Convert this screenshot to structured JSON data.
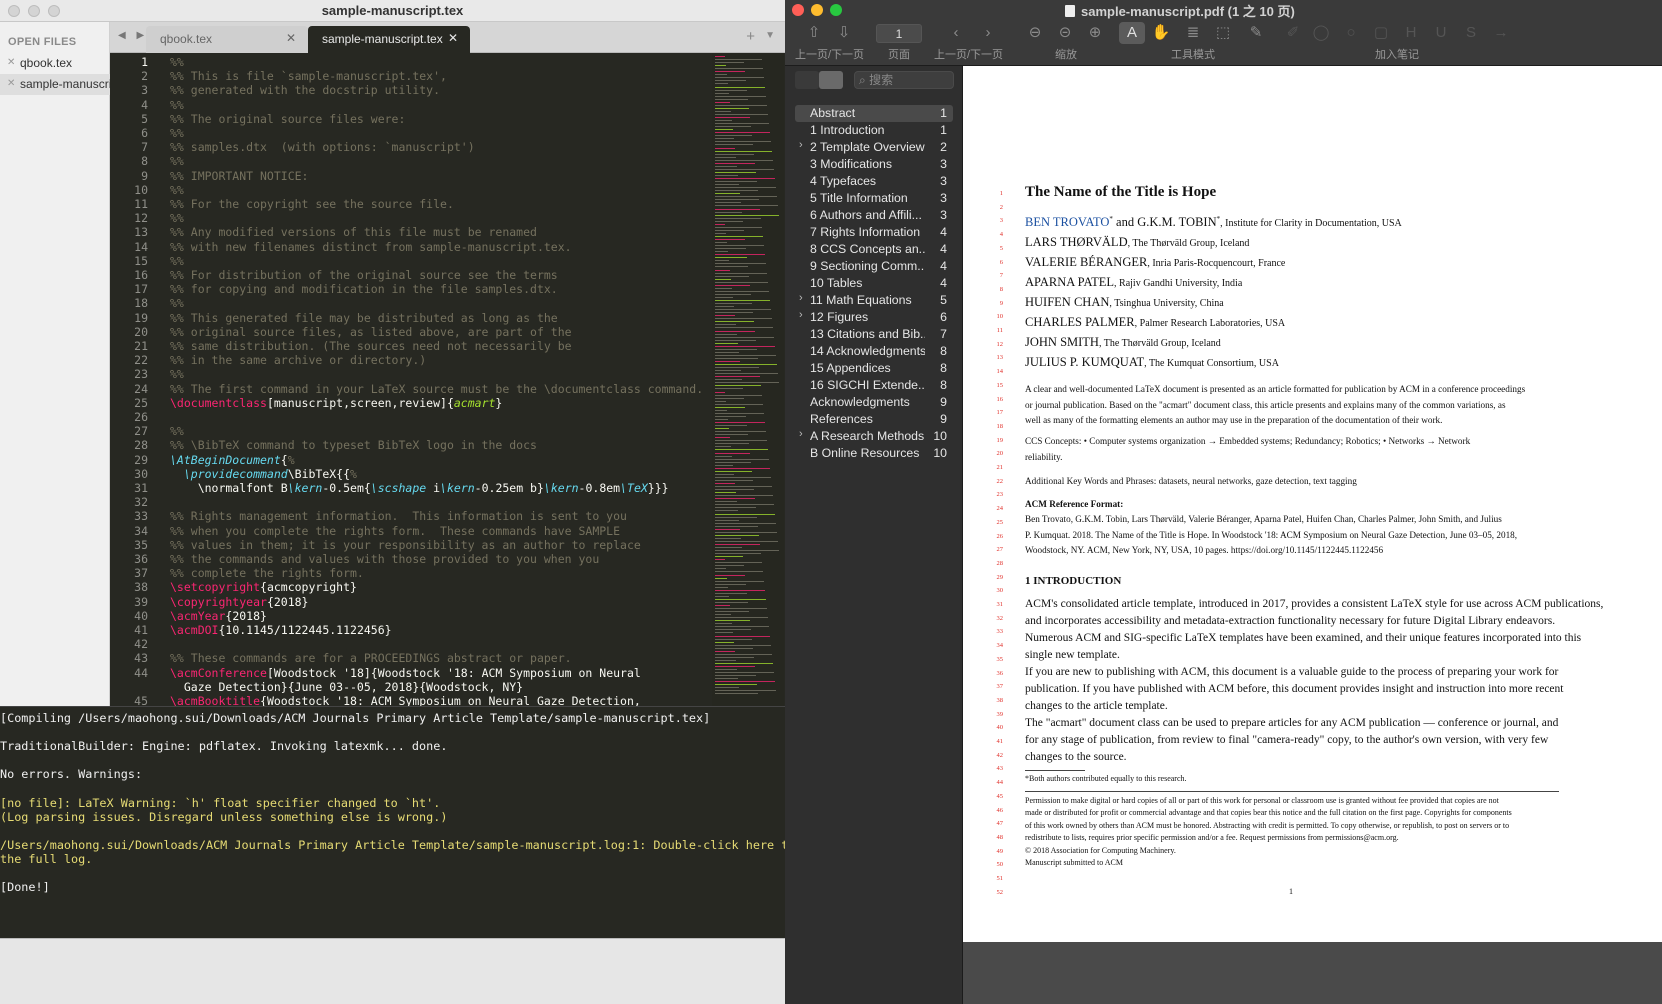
{
  "sublime": {
    "title": "sample-manuscript.tex",
    "sidebar": {
      "header": "OPEN FILES",
      "files": [
        {
          "name": "qbook.tex",
          "close": "✕"
        },
        {
          "name": "sample-manuscript.tex",
          "close": "✕"
        }
      ]
    },
    "tabs": [
      {
        "name": "qbook.tex",
        "close": "✕"
      },
      {
        "name": "sample-manuscript.tex",
        "close": "✕"
      }
    ],
    "tab_nav": "◀ ▶",
    "tab_add": "+",
    "tab_menu": "▼",
    "code_lines": [
      {
        "n": "1",
        "segs": [
          [
            "c",
            "%%"
          ]
        ]
      },
      {
        "n": "2",
        "segs": [
          [
            "c",
            "%% This is file `sample-manuscript.tex',"
          ]
        ]
      },
      {
        "n": "3",
        "segs": [
          [
            "c",
            "%% generated with the docstrip utility."
          ]
        ]
      },
      {
        "n": "4",
        "segs": [
          [
            "c",
            "%%"
          ]
        ]
      },
      {
        "n": "5",
        "segs": [
          [
            "c",
            "%% The original source files were:"
          ]
        ]
      },
      {
        "n": "6",
        "segs": [
          [
            "c",
            "%%"
          ]
        ]
      },
      {
        "n": "7",
        "segs": [
          [
            "c",
            "%% samples.dtx  (with options: `manuscript')"
          ]
        ]
      },
      {
        "n": "8",
        "segs": [
          [
            "c",
            "%%"
          ]
        ]
      },
      {
        "n": "9",
        "segs": [
          [
            "c",
            "%% IMPORTANT NOTICE:"
          ]
        ]
      },
      {
        "n": "10",
        "segs": [
          [
            "c",
            "%%"
          ]
        ]
      },
      {
        "n": "11",
        "segs": [
          [
            "c",
            "%% For the copyright see the source file."
          ]
        ]
      },
      {
        "n": "12",
        "segs": [
          [
            "c",
            "%%"
          ]
        ]
      },
      {
        "n": "13",
        "segs": [
          [
            "c",
            "%% Any modified versions of this file must be renamed"
          ]
        ]
      },
      {
        "n": "14",
        "segs": [
          [
            "c",
            "%% with new filenames distinct from sample-manuscript.tex."
          ]
        ]
      },
      {
        "n": "15",
        "segs": [
          [
            "c",
            "%%"
          ]
        ]
      },
      {
        "n": "16",
        "segs": [
          [
            "c",
            "%% For distribution of the original source see the terms"
          ]
        ]
      },
      {
        "n": "17",
        "segs": [
          [
            "c",
            "%% for copying and modification in the file samples.dtx."
          ]
        ]
      },
      {
        "n": "18",
        "segs": [
          [
            "c",
            "%%"
          ]
        ]
      },
      {
        "n": "19",
        "segs": [
          [
            "c",
            "%% This generated file may be distributed as long as the"
          ]
        ]
      },
      {
        "n": "20",
        "segs": [
          [
            "c",
            "%% original source files, as listed above, are part of the"
          ]
        ]
      },
      {
        "n": "21",
        "segs": [
          [
            "c",
            "%% same distribution. (The sources need not necessarily be"
          ]
        ]
      },
      {
        "n": "22",
        "segs": [
          [
            "c",
            "%% in the same archive or directory.)"
          ]
        ]
      },
      {
        "n": "23",
        "segs": [
          [
            "c",
            "%%"
          ]
        ]
      },
      {
        "n": "24",
        "segs": [
          [
            "c",
            "%% The first command in your LaTeX source must be the \\documentclass command."
          ]
        ]
      },
      {
        "n": "25",
        "segs": [
          [
            "k",
            "\\documentclass"
          ],
          [
            "p",
            "[manuscript,screen,review]{"
          ],
          [
            "i",
            "acmart"
          ],
          [
            "p",
            "}"
          ]
        ]
      },
      {
        "n": "26",
        "segs": [
          [
            "p",
            ""
          ]
        ]
      },
      {
        "n": "27",
        "segs": [
          [
            "c",
            "%%"
          ]
        ]
      },
      {
        "n": "28",
        "segs": [
          [
            "c",
            "%% \\BibTeX command to typeset BibTeX logo in the docs"
          ]
        ]
      },
      {
        "n": "29",
        "segs": [
          [
            "b",
            "\\AtBeginDocument"
          ],
          [
            "p",
            "{"
          ],
          [
            "c",
            "%"
          ]
        ]
      },
      {
        "n": "30",
        "segs": [
          [
            "p",
            "  "
          ],
          [
            "b",
            "\\providecommand"
          ],
          [
            "p",
            "\\BibTeX{{"
          ],
          [
            "c",
            "%"
          ]
        ]
      },
      {
        "n": "31",
        "segs": [
          [
            "p",
            "    \\normalfont B"
          ],
          [
            "b",
            "\\kern"
          ],
          [
            "p",
            "-0.5em{"
          ],
          [
            "b",
            "\\scshape"
          ],
          [
            "p",
            " i"
          ],
          [
            "b",
            "\\kern"
          ],
          [
            "p",
            "-0.25em b}"
          ],
          [
            "b",
            "\\kern"
          ],
          [
            "p",
            "-0.8em"
          ],
          [
            "b",
            "\\TeX"
          ],
          [
            "p",
            "}}}"
          ]
        ]
      },
      {
        "n": "32",
        "segs": [
          [
            "p",
            ""
          ]
        ]
      },
      {
        "n": "33",
        "segs": [
          [
            "c",
            "%% Rights management information.  This information is sent to you"
          ]
        ]
      },
      {
        "n": "34",
        "segs": [
          [
            "c",
            "%% when you complete the rights form.  These commands have SAMPLE"
          ]
        ]
      },
      {
        "n": "35",
        "segs": [
          [
            "c",
            "%% values in them; it is your responsibility as an author to replace"
          ]
        ]
      },
      {
        "n": "36",
        "segs": [
          [
            "c",
            "%% the commands and values with those provided to you when you"
          ]
        ]
      },
      {
        "n": "37",
        "segs": [
          [
            "c",
            "%% complete the rights form."
          ]
        ]
      },
      {
        "n": "38",
        "segs": [
          [
            "k",
            "\\setcopyright"
          ],
          [
            "p",
            "{acmcopyright}"
          ]
        ]
      },
      {
        "n": "39",
        "segs": [
          [
            "k",
            "\\copyrightyear"
          ],
          [
            "p",
            "{2018}"
          ]
        ]
      },
      {
        "n": "40",
        "segs": [
          [
            "k",
            "\\acmYear"
          ],
          [
            "p",
            "{2018}"
          ]
        ]
      },
      {
        "n": "41",
        "segs": [
          [
            "k",
            "\\acmDOI"
          ],
          [
            "p",
            "{10.1145/1122445.1122456}"
          ]
        ]
      },
      {
        "n": "42",
        "segs": [
          [
            "p",
            ""
          ]
        ]
      },
      {
        "n": "43",
        "segs": [
          [
            "c",
            "%% These commands are for a PROCEEDINGS abstract or paper."
          ]
        ]
      },
      {
        "n": "44",
        "segs": [
          [
            "k",
            "\\acmConference"
          ],
          [
            "p",
            "[Woodstock '18]{Woodstock '18: ACM Symposium on Neural"
          ]
        ]
      },
      {
        "n": "",
        "segs": [
          [
            "p",
            "  Gaze Detection}{June 03--05, 2018}{Woodstock, NY}"
          ]
        ]
      },
      {
        "n": "45",
        "segs": [
          [
            "k",
            "\\acmBooktitle"
          ],
          [
            "p",
            "{Woodstock '18: ACM Symposium on Neural Gaze Detection,"
          ]
        ]
      },
      {
        "n": "46",
        "segs": [
          [
            "p",
            "  June 03--05, 2018, Woodstock, NY}"
          ]
        ]
      }
    ],
    "console_lines": [
      {
        "t": "[Compiling /Users/maohong.sui/Downloads/ACM Journals Primary Article Template/sample-manuscript.tex]",
        "y": false
      },
      {
        "t": "",
        "y": false
      },
      {
        "t": "TraditionalBuilder: Engine: pdflatex. Invoking latexmk... done.",
        "y": false
      },
      {
        "t": "",
        "y": false
      },
      {
        "t": "No errors. Warnings:",
        "y": false
      },
      {
        "t": "",
        "y": false
      },
      {
        "t": "[no file]: LaTeX Warning: `h' float specifier changed to `ht'.",
        "y": true
      },
      {
        "t": "(Log parsing issues. Disregard unless something else is wrong.)",
        "y": true
      },
      {
        "t": "",
        "y": false
      },
      {
        "t": "/Users/maohong.sui/Downloads/ACM Journals Primary Article Template/sample-manuscript.log:1: Double-click here to open",
        "y": true
      },
      {
        "t": "the full log.",
        "y": true
      },
      {
        "t": "",
        "y": false
      },
      {
        "t": "[Done!]",
        "y": false
      }
    ]
  },
  "preview": {
    "title": "sample-manuscript.pdf (1 之 10 页)",
    "page_field": "1",
    "toolbar_labels": {
      "prevnext1": "上一页/下一页",
      "page": "页面",
      "prevnext2": "上一页/下一页",
      "zoom": "缩放",
      "toolmode": "工具模式",
      "annotate": "加入笔记"
    },
    "search_placeholder": "搜索",
    "toc": [
      {
        "label": "Abstract",
        "page": "1",
        "chev": "",
        "sel": true
      },
      {
        "label": "1 Introduction",
        "page": "1",
        "chev": "",
        "sel": false
      },
      {
        "label": "2 Template Overview",
        "page": "2",
        "chev": "›",
        "sel": false
      },
      {
        "label": "3 Modifications",
        "page": "3",
        "chev": "",
        "sel": false
      },
      {
        "label": "4 Typefaces",
        "page": "3",
        "chev": "",
        "sel": false
      },
      {
        "label": "5 Title Information",
        "page": "3",
        "chev": "",
        "sel": false
      },
      {
        "label": "6 Authors and Affili...",
        "page": "3",
        "chev": "",
        "sel": false
      },
      {
        "label": "7 Rights Information",
        "page": "4",
        "chev": "",
        "sel": false
      },
      {
        "label": "8 CCS Concepts an...",
        "page": "4",
        "chev": "",
        "sel": false
      },
      {
        "label": "9 Sectioning Comm...",
        "page": "4",
        "chev": "",
        "sel": false
      },
      {
        "label": "10 Tables",
        "page": "4",
        "chev": "",
        "sel": false
      },
      {
        "label": "11 Math Equations",
        "page": "5",
        "chev": "›",
        "sel": false
      },
      {
        "label": "12 Figures",
        "page": "6",
        "chev": "›",
        "sel": false
      },
      {
        "label": "13 Citations and Bib...",
        "page": "7",
        "chev": "",
        "sel": false
      },
      {
        "label": "14 Acknowledgments",
        "page": "8",
        "chev": "",
        "sel": false
      },
      {
        "label": "15 Appendices",
        "page": "8",
        "chev": "",
        "sel": false
      },
      {
        "label": "16 SIGCHI Extende...",
        "page": "8",
        "chev": "",
        "sel": false
      },
      {
        "label": "Acknowledgments",
        "page": "9",
        "chev": "",
        "sel": false
      },
      {
        "label": "References",
        "page": "9",
        "chev": "",
        "sel": false
      },
      {
        "label": "A Research Methods",
        "page": "10",
        "chev": "›",
        "sel": false
      },
      {
        "label": "B Online Resources",
        "page": "10",
        "chev": "",
        "sel": false
      }
    ],
    "paper": {
      "title": "The Name of the Title is Hope",
      "authors": [
        {
          "name": "BEN TROVATO",
          "sup": "*",
          "aff": ", Institute for Clarity in Documentation, USA",
          "blue": true
        },
        {
          "name": "and G.K.M. TOBIN",
          "sup": "*",
          "aff": ", Institute for Clarity in Documentation, USA",
          "blue": false
        },
        {
          "name": "LARS THØRVÄLD",
          "sup": "",
          "aff": ", The Thørväld Group, Iceland",
          "blue": false
        },
        {
          "name": "VALERIE BÉRANGER",
          "sup": "",
          "aff": ", Inria Paris-Rocquencourt, France",
          "blue": false
        },
        {
          "name": "APARNA PATEL",
          "sup": "",
          "aff": ", Rajiv Gandhi University, India",
          "blue": false
        },
        {
          "name": "HUIFEN CHAN",
          "sup": "",
          "aff": ", Tsinghua University, China",
          "blue": false
        },
        {
          "name": "CHARLES PALMER",
          "sup": "",
          "aff": ", Palmer Research Laboratories, USA",
          "blue": false
        },
        {
          "name": "JOHN SMITH",
          "sup": "",
          "aff": ", The Thørväld Group, Iceland",
          "blue": false
        },
        {
          "name": "JULIUS P. KUMQUAT",
          "sup": "",
          "aff": ", The Kumquat Consortium, USA",
          "blue": false
        }
      ],
      "abstract": [
        "A clear and well-documented LaTeX document is presented as an article formatted for publication by ACM in a conference proceedings",
        "or journal publication. Based on the \"acmart\" document class, this article presents and explains many of the common variations, as",
        "well as many of the formatting elements an author may use in the preparation of the documentation of their work."
      ],
      "ccs": [
        "CCS Concepts: • Computer systems organization → Embedded systems; Redundancy; Robotics; • Networks → Network",
        "reliability."
      ],
      "keywords": "Additional Key Words and Phrases: datasets, neural networks, gaze detection, text tagging",
      "ref_head": "ACM Reference Format:",
      "ref_lines": [
        "Ben Trovato, G.K.M. Tobin, Lars Thørväld, Valerie Béranger, Aparna Patel, Huifen Chan, Charles Palmer, John Smith, and Julius",
        "P. Kumquat. 2018. The Name of the Title is Hope. In Woodstock '18: ACM Symposium on Neural Gaze Detection, June 03–05, 2018,",
        "Woodstock, NY. ACM, New York, NY, USA, 10 pages. https://doi.org/10.1145/1122445.1122456"
      ],
      "section": "1   INTRODUCTION",
      "intro_lines": [
        "ACM's consolidated article template, introduced in 2017, provides a consistent LaTeX style for use across ACM publications,",
        "and incorporates accessibility and metadata-extraction functionality necessary for future Digital Library endeavors.",
        "Numerous ACM and SIG-specific LaTeX templates have been examined, and their unique features incorporated into this",
        "single new template.",
        "    If you are new to publishing with ACM, this document is a valuable guide to the process of preparing your work for",
        "publication. If you have published with ACM before, this document provides insight and instruction into more recent",
        "changes to the article template.",
        "    The \"acmart\" document class can be used to prepare articles for any ACM publication — conference or journal, and",
        "for any stage of publication, from review to final \"camera-ready\" copy, to the author's own version, with very few",
        "changes to the source."
      ],
      "footnote": "*Both authors contributed equally to this research.",
      "permission": [
        "Permission to make digital or hard copies of all or part of this work for personal or classroom use is granted without fee provided that copies are not",
        "made or distributed for profit or commercial advantage and that copies bear this notice and the full citation on the first page. Copyrights for components",
        "of this work owned by others than ACM must be honored. Abstracting with credit is permitted. To copy otherwise, or republish, to post on servers or to",
        "redistribute to lists, requires prior specific permission and/or a fee. Request permissions from permissions@acm.org.",
        "© 2018 Association for Computing Machinery.",
        "Manuscript submitted to ACM"
      ],
      "page_number": "1",
      "review_lines": [
        "1",
        "2",
        "3",
        "4",
        "5",
        "6",
        "7",
        "8",
        "9",
        "10",
        "11",
        "12",
        "13",
        "14",
        "15",
        "16",
        "17",
        "18",
        "19",
        "20",
        "21",
        "22",
        "23",
        "24",
        "25",
        "26",
        "27",
        "28",
        "29",
        "30",
        "31",
        "32",
        "33",
        "34",
        "35",
        "36",
        "37",
        "38",
        "39",
        "40",
        "41",
        "42",
        "43",
        "44",
        "45",
        "46",
        "47",
        "48",
        "49",
        "50",
        "51",
        "52"
      ]
    }
  },
  "colors": {
    "editor_bg": "#272822",
    "comment": "#75715e",
    "keyword": "#f92672",
    "string": "#e6db74",
    "italic": "#66d9ef",
    "link_blue": "#1a4fa0",
    "review_red": "#e0302a"
  }
}
